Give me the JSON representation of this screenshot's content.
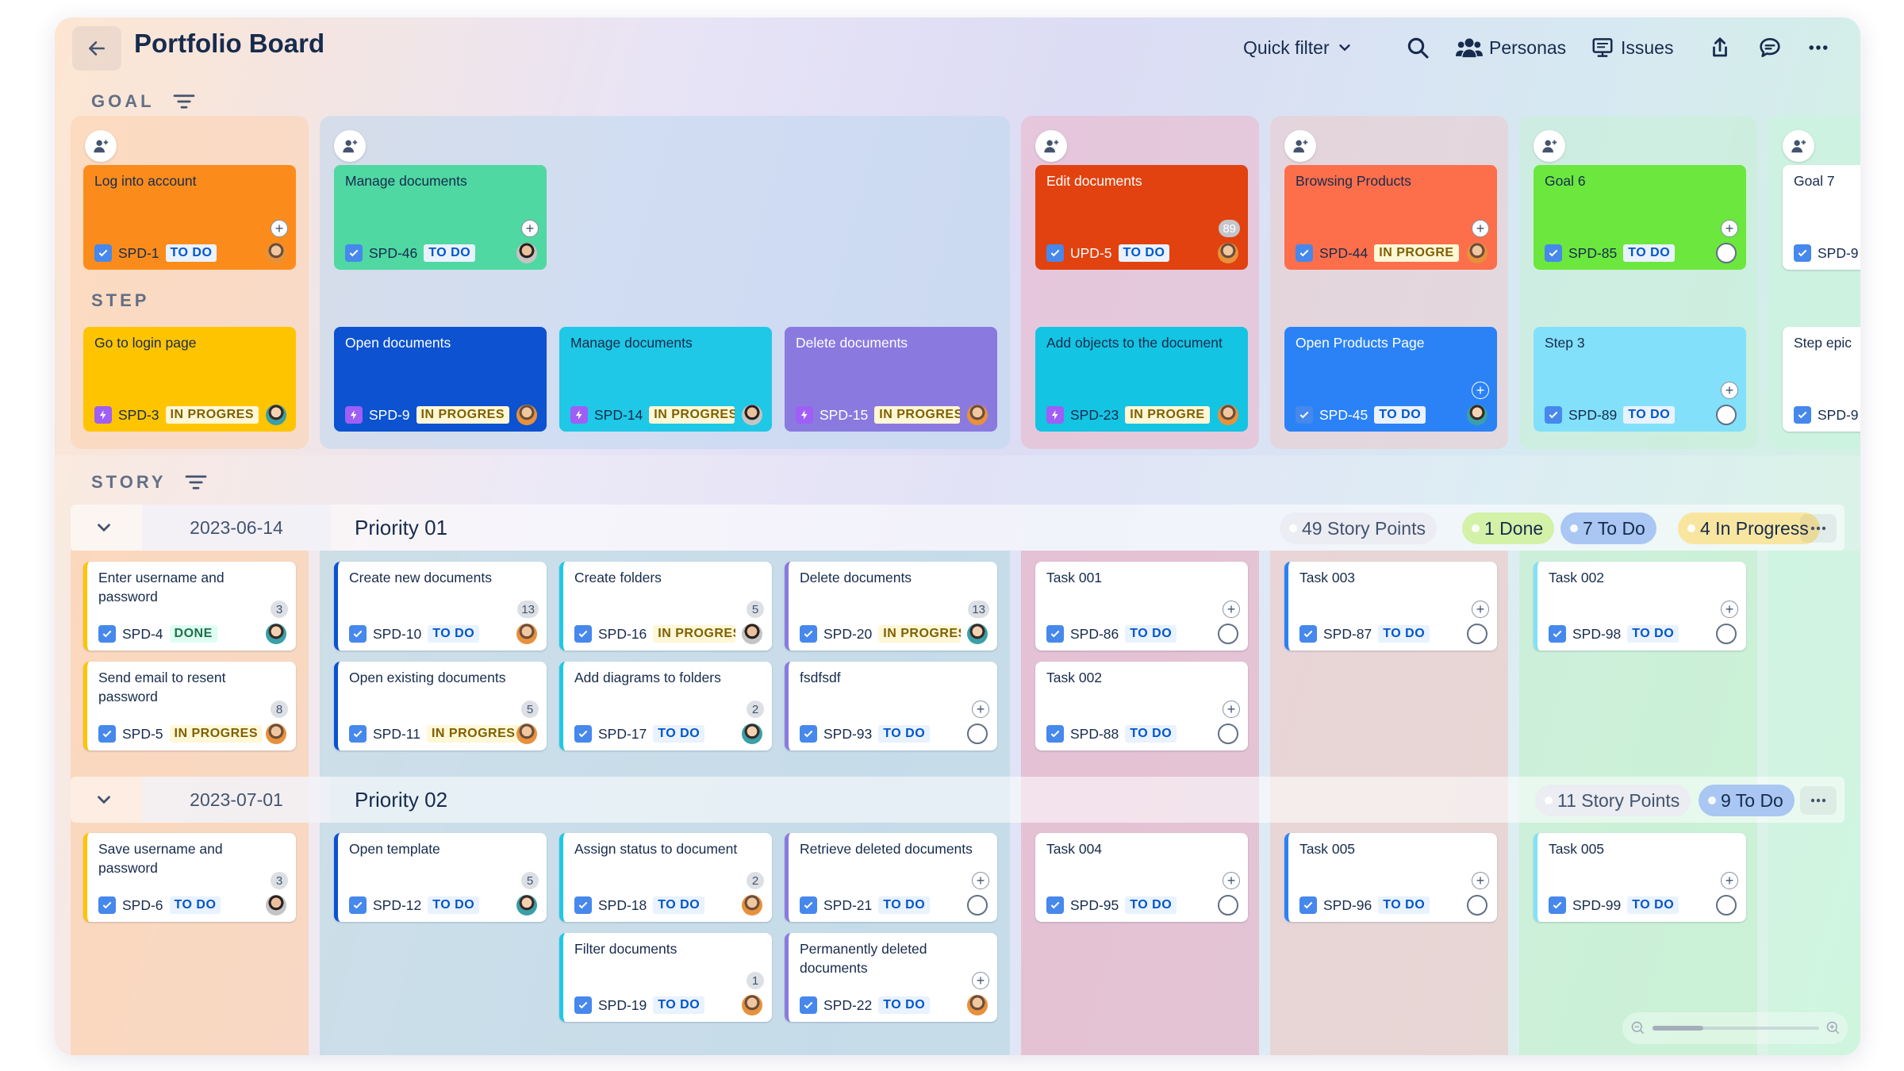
{
  "header": {
    "title": "Portfolio Board",
    "quick_filter": "Quick filter",
    "personas": "Personas",
    "issues": "Issues"
  },
  "sections": {
    "goal": "GOAL",
    "step": "STEP",
    "story": "STORY"
  },
  "goals": [
    {
      "name": "Log into account",
      "key": "SPD-1",
      "status": "TO DO",
      "color": "#fb8c1c"
    },
    {
      "name": "Manage documents",
      "key": "SPD-46",
      "status": "TO DO",
      "color": "#4fd8a2"
    },
    {
      "name": "Edit documents",
      "key": "UPD-5",
      "status": "TO DO",
      "color": "#e2420f",
      "points": "89"
    },
    {
      "name": "Browsing Products",
      "key": "SPD-44",
      "status": "IN PROGRE",
      "color": "#fd6f4b"
    },
    {
      "name": "Goal 6",
      "key": "SPD-85",
      "status": "TO DO",
      "color": "#6be73e"
    },
    {
      "name": "Goal 7",
      "key": "SPD-9",
      "status": "",
      "color": "#ffffff"
    }
  ],
  "steps": [
    {
      "name": "Go to login page",
      "key": "SPD-3",
      "status": "IN PROGRES",
      "color": "#ffc400"
    },
    {
      "name": "Open documents",
      "key": "SPD-9",
      "status": "IN PROGRES",
      "color": "#0c52d1"
    },
    {
      "name": "Manage documents",
      "key": "SPD-14",
      "status": "IN PROGRES",
      "color": "#1ec8e6"
    },
    {
      "name": "Delete documents",
      "key": "SPD-15",
      "status": "IN PROGRES",
      "color": "#8a7ae0"
    },
    {
      "name": "Add objects to the document",
      "key": "SPD-23",
      "status": "IN PROGRE",
      "color": "#13c4e3"
    },
    {
      "name": "Open Products Page",
      "key": "SPD-45",
      "status": "TO DO",
      "color": "#2b82f6"
    },
    {
      "name": "Step 3",
      "key": "SPD-89",
      "status": "TO DO",
      "color": "#82e0fa"
    },
    {
      "name": "Step epic",
      "key": "SPD-9",
      "status": "",
      "color": "#ffffff"
    }
  ],
  "swimlanes": [
    {
      "date": "2023-06-14",
      "priority": "Priority 01",
      "pills": [
        "49 Story Points",
        "1 Done",
        "7 To Do",
        "4 In Progress"
      ],
      "cards": [
        {
          "name": "Enter username and password",
          "key": "SPD-4",
          "status": "DONE",
          "points": "3"
        },
        {
          "name": "Send email to resent password",
          "key": "SPD-5",
          "status": "IN PROGRES",
          "points": "8"
        },
        {
          "name": "Create new documents",
          "key": "SPD-10",
          "status": "TO DO",
          "points": "13"
        },
        {
          "name": "Open existing documents",
          "key": "SPD-11",
          "status": "IN PROGRES",
          "points": "5"
        },
        {
          "name": "Create folders",
          "key": "SPD-16",
          "status": "IN PROGRES",
          "points": "5"
        },
        {
          "name": "Add diagrams to folders",
          "key": "SPD-17",
          "status": "TO DO",
          "points": "2"
        },
        {
          "name": "Delete documents",
          "key": "SPD-20",
          "status": "IN PROGRES",
          "points": "13"
        },
        {
          "name": "fsdfsdf",
          "key": "SPD-93",
          "status": "TO DO",
          "points": ""
        },
        {
          "name": "Task 001",
          "key": "SPD-86",
          "status": "TO DO",
          "points": ""
        },
        {
          "name": "Task 002",
          "key": "SPD-88",
          "status": "TO DO",
          "points": ""
        },
        {
          "name": "Task 003",
          "key": "SPD-87",
          "status": "TO DO",
          "points": ""
        },
        {
          "name": "Task 002",
          "key": "SPD-98",
          "status": "TO DO",
          "points": ""
        }
      ]
    },
    {
      "date": "2023-07-01",
      "priority": "Priority 02",
      "pills": [
        "11 Story Points",
        "9 To Do"
      ],
      "cards": [
        {
          "name": "Save username and password",
          "key": "SPD-6",
          "status": "TO DO",
          "points": "3"
        },
        {
          "name": "Open template",
          "key": "SPD-12",
          "status": "TO DO",
          "points": "5"
        },
        {
          "name": "Assign status to document",
          "key": "SPD-18",
          "status": "TO DO",
          "points": "2"
        },
        {
          "name": "Filter documents",
          "key": "SPD-19",
          "status": "TO DO",
          "points": "1"
        },
        {
          "name": "Retrieve deleted documents",
          "key": "SPD-21",
          "status": "TO DO",
          "points": ""
        },
        {
          "name": "Permanently deleted documents",
          "key": "SPD-22",
          "status": "TO DO",
          "points": ""
        },
        {
          "name": "Task 004",
          "key": "SPD-95",
          "status": "TO DO",
          "points": ""
        },
        {
          "name": "Task 005",
          "key": "SPD-96",
          "status": "TO DO",
          "points": ""
        },
        {
          "name": "Task 005",
          "key": "SPD-99",
          "status": "TO DO",
          "points": ""
        }
      ]
    }
  ]
}
